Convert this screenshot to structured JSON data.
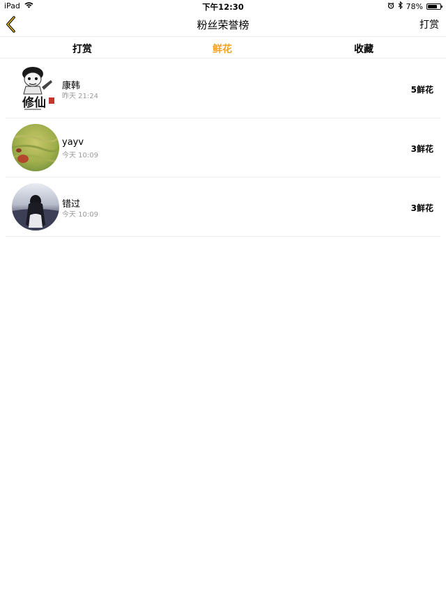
{
  "status_bar": {
    "device": "iPad",
    "time": "下午12:30",
    "battery": "78%",
    "battery_level": 0.78,
    "icons": [
      "wifi-icon",
      "alarm-icon",
      "bluetooth-icon",
      "battery-icon"
    ]
  },
  "nav": {
    "back_icon": "chevron-left-icon",
    "title": "粉丝荣誉榜",
    "right_action": "打赏"
  },
  "tabs": [
    {
      "label": "打赏",
      "active": false
    },
    {
      "label": "鲜花",
      "active": true
    },
    {
      "label": "收藏",
      "active": false
    }
  ],
  "rows": [
    {
      "name": "康韩",
      "time": "昨天 21:24",
      "amount": "5鲜花",
      "avatar": "meme-avatar",
      "avatar_text": "修仙"
    },
    {
      "name": "yayv",
      "time": "今天 10:09",
      "amount": "3鲜花",
      "avatar": "grass-field-avatar"
    },
    {
      "name": "错过",
      "time": "今天 10:09",
      "amount": "3鲜花",
      "avatar": "girl-silhouette-avatar"
    }
  ],
  "colors": {
    "accent": "#f1a423",
    "divider": "#ececec",
    "secondary_text": "#9a9a9a"
  }
}
